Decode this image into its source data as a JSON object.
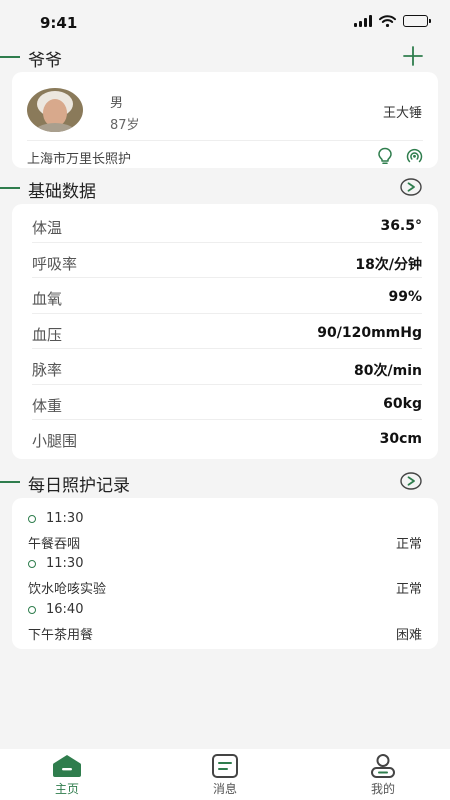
{
  "status": {
    "time": "9:41"
  },
  "profile": {
    "section_title": "爷爷",
    "gender": "男",
    "age": "87岁",
    "name": "王大锤",
    "address": "上海市万里长照护"
  },
  "basic": {
    "section_title": "基础数据",
    "rows": [
      {
        "label": "体温",
        "value": "36.5°"
      },
      {
        "label": "呼吸率",
        "value": "18次/分钟"
      },
      {
        "label": "血氧",
        "value": "99%"
      },
      {
        "label": "血压",
        "value": "90/120mmHg"
      },
      {
        "label": "脉率",
        "value": "80次/min"
      },
      {
        "label": "体重",
        "value": "60kg"
      },
      {
        "label": "小腿围",
        "value": "30cm"
      }
    ]
  },
  "records": {
    "section_title": "每日照护记录",
    "items": [
      {
        "time": "11:30",
        "desc": "午餐吞咽",
        "status": "正常"
      },
      {
        "time": "11:30",
        "desc": "饮水呛咳实验",
        "status": "正常"
      },
      {
        "time": "16:40",
        "desc": "下午茶用餐",
        "status": "困难"
      }
    ]
  },
  "tabs": [
    {
      "label": "主页",
      "active": true,
      "icon": "home-icon"
    },
    {
      "label": "消息",
      "active": false,
      "icon": "message-icon"
    },
    {
      "label": "我的",
      "active": false,
      "icon": "profile-icon"
    }
  ],
  "colors": {
    "accent": "#2f7d4d",
    "background": "#f4f4f4",
    "card": "#ffffff"
  }
}
